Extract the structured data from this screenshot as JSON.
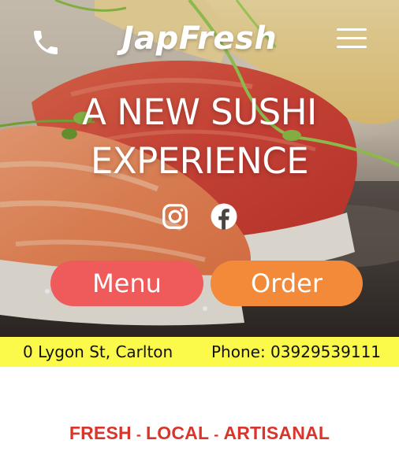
{
  "header": {
    "brand": "JapFresh",
    "phone_icon": "phone-icon",
    "menu_icon": "hamburger-menu-icon"
  },
  "hero": {
    "line1": "A NEW SUSHI",
    "line2": "EXPERIENCE",
    "social_icons": [
      "instagram-icon",
      "facebook-icon"
    ],
    "menu_button": "Menu",
    "order_button": "Order"
  },
  "info_bar": {
    "address": "0 Lygon St, Carlton",
    "phone": "Phone: 03929539111"
  },
  "tagline": {
    "word1": "FRESH",
    "sep1": "-",
    "word2": "LOCAL",
    "sep2": "-",
    "word3": "ARTISANAL"
  },
  "colors": {
    "menu_button": "#ef5b5b",
    "order_button": "#f28a3a",
    "info_bar": "#fbf94a",
    "tagline": "#d9352b"
  }
}
